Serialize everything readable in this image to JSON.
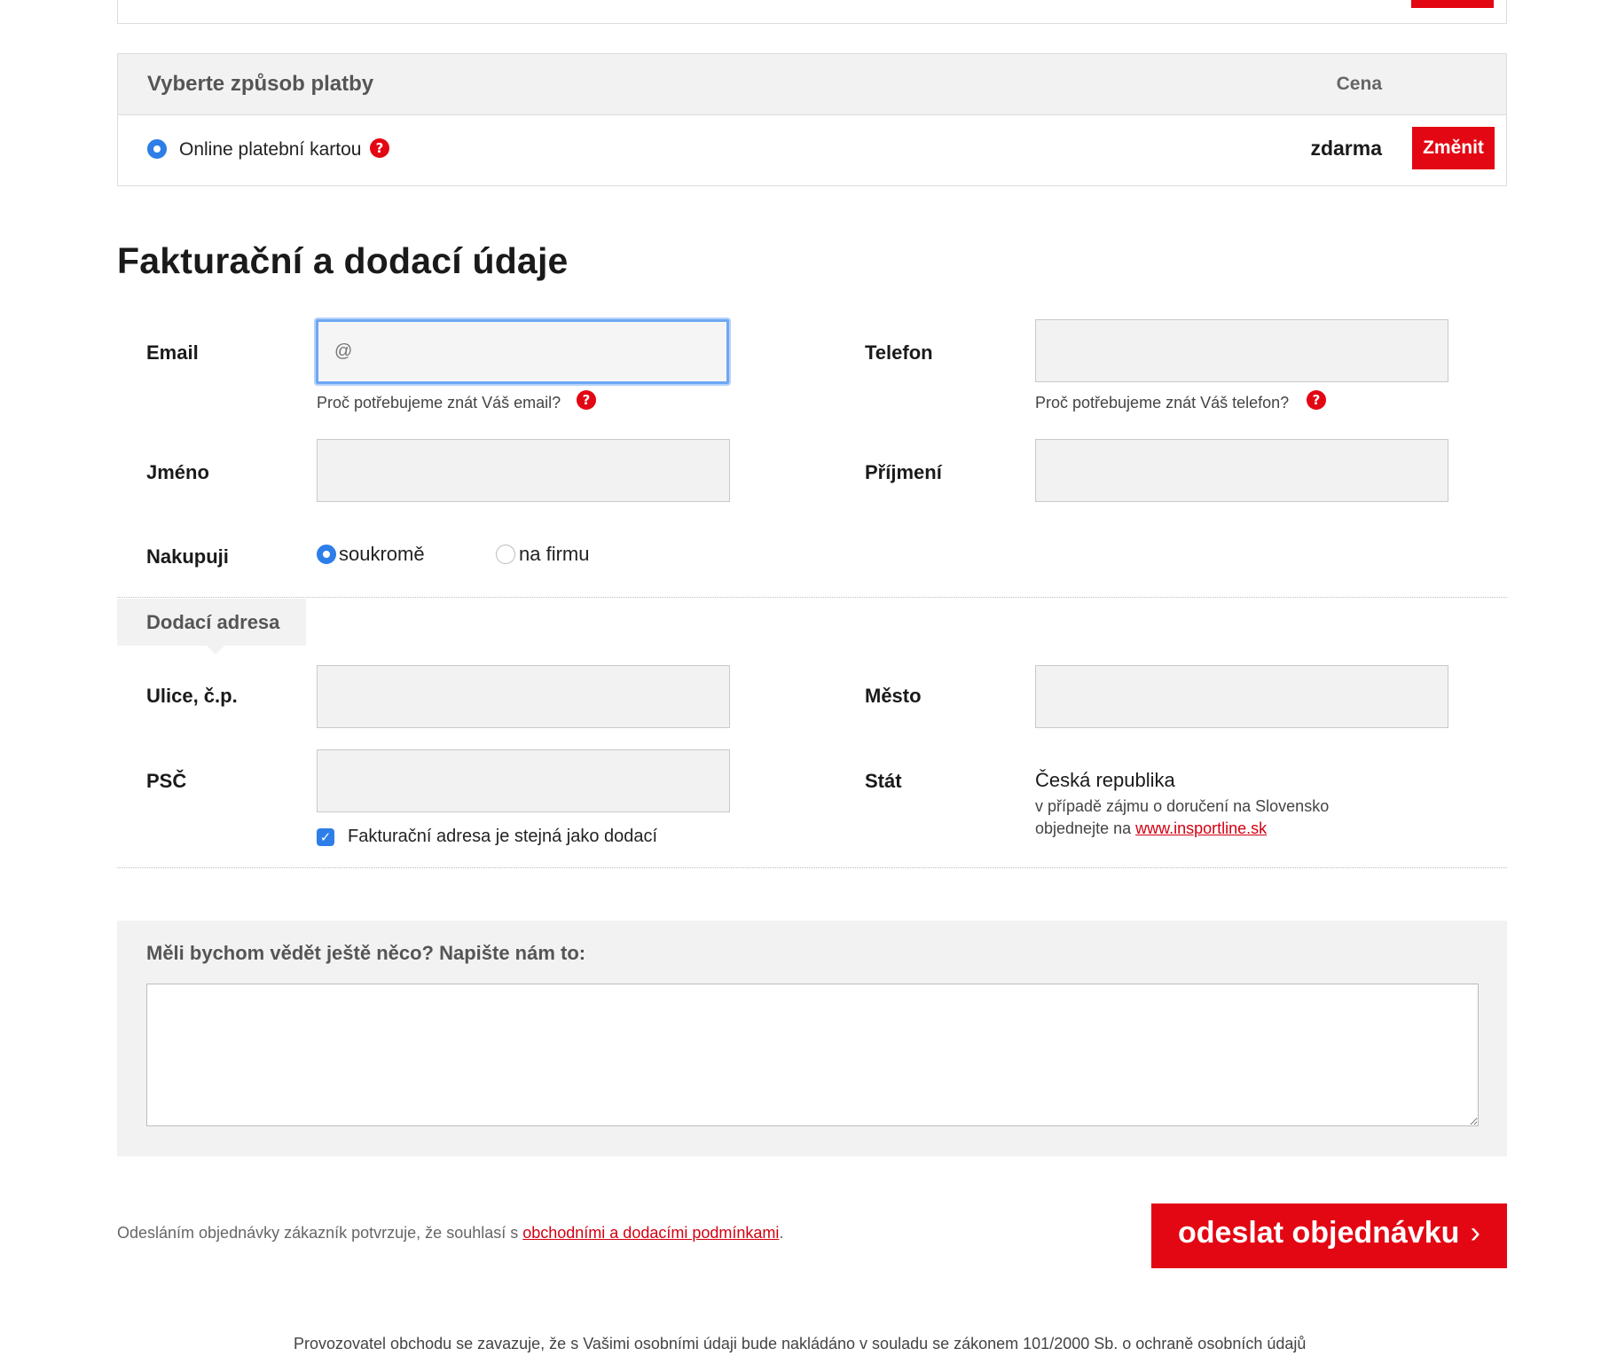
{
  "payment": {
    "title": "Vyberte způsob platby",
    "price_header": "Cena",
    "option_label": "Online platební kartou",
    "option_price": "zdarma",
    "change_label": "Změnit",
    "help_glyph": "?"
  },
  "billing": {
    "title": "Fakturační a dodací údaje",
    "email_label": "Email",
    "email_placeholder": "@",
    "email_hint": "Proč potřebujeme znát Váš email?",
    "phone_label": "Telefon",
    "phone_hint": "Proč potřebujeme znát Váš telefon?",
    "first_name_label": "Jméno",
    "last_name_label": "Příjmení",
    "buying_label": "Nakupuji",
    "buying_options": [
      "soukromě",
      "na firmu"
    ],
    "buying_selected": "soukromě"
  },
  "delivery": {
    "tab_label": "Dodací adresa",
    "street_label": "Ulice, č.p.",
    "city_label": "Město",
    "zip_label": "PSČ",
    "country_label": "Stát",
    "country_value": "Česká republika",
    "country_note_line1": "v případě zájmu o doručení na Slovensko",
    "country_note_line2_prefix": "objednejte na ",
    "country_note_link": "www.insportline.sk",
    "same_address_label": "Fakturační adresa je stejná jako dodací",
    "same_address_checked": true
  },
  "notes": {
    "label": "Měli bychom vědět ještě něco? Napište nám to:",
    "value": ""
  },
  "footer": {
    "consent_prefix": "Odesláním objednávky zákazník potvrzuje, že souhlasí s ",
    "consent_link": "obchodními a dodacími podmínkami",
    "consent_suffix": ".",
    "submit_label": "odeslat objednávku",
    "submit_chevron": "›",
    "privacy_note": "Provozovatel obchodu se zavazuje, že s Vašimi osobními údaji bude nakládáno v souladu se zákonem 101/2000 Sb. o ochraně osobních údajů"
  },
  "colors": {
    "accent_red": "#e30613",
    "radio_blue": "#2d7ee8",
    "panel_grey": "#f2f2f2"
  }
}
